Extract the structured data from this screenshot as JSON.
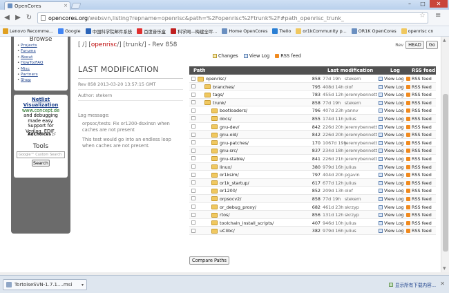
{
  "browser": {
    "tab_title": "OpenCores",
    "tab_close": "×",
    "win_min": "–",
    "win_max": "□",
    "win_close": "✕",
    "url_domain": "opencores.org",
    "url_rest": "/websvn,listing?repname=openrisc&path=%2Fopenrisc%2Ftrunk%2F#path_openrisc_trunk_",
    "bookmarks": [
      {
        "label": "Lenovo Recomme...",
        "color": "#e0a020"
      },
      {
        "label": "Google",
        "color": "#4285f4"
      },
      {
        "label": "中国科学院邮件系统",
        "color": "#2a64b8"
      },
      {
        "label": "百度音乐盒",
        "color": "#e03030"
      },
      {
        "label": "科学网—梅建全坪...",
        "color": "#c02020"
      },
      {
        "label": "Home OpenCores",
        "color": "#6a8fc0"
      },
      {
        "label": "Trello",
        "color": "#2a7fd4"
      },
      {
        "label": "or1kCommunity p...",
        "color": "#f0c860"
      },
      {
        "label": "OR1K OpenCores",
        "color": "#6a8fc0"
      },
      {
        "label": "openrisc cn",
        "color": "#f0c860"
      }
    ]
  },
  "sidebar": {
    "browse_title": "Browse",
    "links": [
      "Projects",
      "Forums",
      "About",
      "HowTo/FAQ",
      "Misc",
      "Partners",
      "Shop"
    ],
    "ad": {
      "headline1": "Netlist",
      "headline2": "Visualization",
      "url": "www.concept.de",
      "desc1": "and debugging",
      "desc2": "made easy.",
      "desc3": "Support for",
      "desc4": "Verilog, EDIF,",
      "adchoices": "AdChoices ▷"
    },
    "tools_title": "Tools",
    "search_placeholder": "Google™ Custom Search",
    "search_button": "Search"
  },
  "header": {
    "bracket_open": "[",
    "root": "/",
    "mid1": "] [",
    "repo": "openrisc",
    "sep": "/",
    "mid2": "] [",
    "dir": "trunk",
    "close": "/] - Rev 858",
    "rev_label": "Rev",
    "head_btn": "HEAD",
    "go_btn": "Go"
  },
  "actions": {
    "changes": "Changes",
    "view_log": "View Log",
    "rss": "RSS feed"
  },
  "last_mod": {
    "title": "LAST MODIFICATION",
    "rev_line": "Rev 858 2013-03-20 13:57:15 GMT",
    "author": "Author: stekern",
    "log_label": "Log message:",
    "msg1": "orpsoc/tests: Fix or1200-dsxinsn when caches are not present",
    "msg2": "This test would go into an endless loop when caches are not present."
  },
  "table": {
    "headers": {
      "path": "Path",
      "lastmod": "Last modification",
      "log": "Log",
      "rss": "RSS feed"
    },
    "view_log": "View Log",
    "rss_feed": "RSS feed",
    "rows": [
      {
        "name": "openrisc/",
        "depth": 0,
        "rev": "858",
        "age": "77d 19h",
        "author": "stekern"
      },
      {
        "name": "branches/",
        "depth": 1,
        "rev": "795",
        "age": "408d 14h",
        "author": "olof"
      },
      {
        "name": "tags/",
        "depth": 1,
        "rev": "783",
        "age": "455d 12h",
        "author": "jeremybennett"
      },
      {
        "name": "trunk/",
        "depth": 1,
        "rev": "858",
        "age": "77d 19h",
        "author": "stekern"
      },
      {
        "name": "bootloaders/",
        "depth": 2,
        "rev": "796",
        "age": "407d 23h",
        "author": "yannv"
      },
      {
        "name": "docs/",
        "depth": 2,
        "rev": "855",
        "age": "174d 11h",
        "author": "julius"
      },
      {
        "name": "gnu-dev/",
        "depth": 2,
        "rev": "842",
        "age": "226d 20h",
        "author": "jeremybennett"
      },
      {
        "name": "gnu-old/",
        "depth": 2,
        "rev": "842",
        "age": "226d 20h",
        "author": "jeremybennett"
      },
      {
        "name": "gnu-patches/",
        "depth": 2,
        "rev": "170",
        "age": "1067d 19h",
        "author": "jeremybennett"
      },
      {
        "name": "gnu-src/",
        "depth": 2,
        "rev": "837",
        "age": "234d 18h",
        "author": "jeremybennett"
      },
      {
        "name": "gnu-stable/",
        "depth": 2,
        "rev": "841",
        "age": "226d 21h",
        "author": "jeremybennett"
      },
      {
        "name": "linux/",
        "depth": 2,
        "rev": "380",
        "age": "979d 16h",
        "author": "julius"
      },
      {
        "name": "or1ksim/",
        "depth": 2,
        "rev": "797",
        "age": "404d 20h",
        "author": "pgavin"
      },
      {
        "name": "or1k_startup/",
        "depth": 2,
        "rev": "617",
        "age": "677d 12h",
        "author": "julius"
      },
      {
        "name": "or1200/",
        "depth": 2,
        "rev": "852",
        "age": "209d 13h",
        "author": "olof"
      },
      {
        "name": "orpsocv2/",
        "depth": 2,
        "rev": "858",
        "age": "77d 19h",
        "author": "stekern"
      },
      {
        "name": "or_debug_proxy/",
        "depth": 2,
        "rev": "682",
        "age": "461d 23h",
        "author": "skrzyp"
      },
      {
        "name": "rtos/",
        "depth": 2,
        "rev": "856",
        "age": "131d 12h",
        "author": "skrzyp"
      },
      {
        "name": "toolchain_install_scripts/",
        "depth": 2,
        "rev": "407",
        "age": "946d 10h",
        "author": "julius"
      },
      {
        "name": "uClibc/",
        "depth": 2,
        "rev": "382",
        "age": "979d 16h",
        "author": "julius"
      }
    ],
    "compare_btn": "Compare Paths"
  },
  "downloads": {
    "file": "TortoiseSVN-1.7.1....msi",
    "arrow": "▾",
    "show_all": "显示所有下载内容...",
    "close": "✕"
  }
}
